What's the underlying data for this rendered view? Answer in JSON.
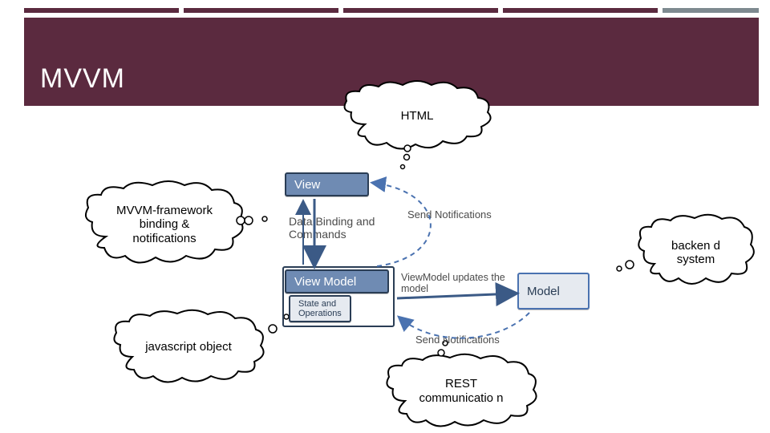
{
  "header": {
    "title": "MVVM"
  },
  "clouds": {
    "html": "HTML",
    "mvvmfw": "MVVM-framework binding & notifications",
    "jsobj": "javascript object",
    "rest": "REST communicatio n",
    "backend": "backen d system"
  },
  "boxes": {
    "view": "View",
    "viewmodel": "View Model",
    "stateops": "State and Operations",
    "model": "Model"
  },
  "handwritten": {
    "databinding": "Data Binding and Commands",
    "sendnotif_top": "Send Notifications",
    "vm_updates": "ViewModel updates the model",
    "sendnotif_bottom": "Send Notifications"
  }
}
